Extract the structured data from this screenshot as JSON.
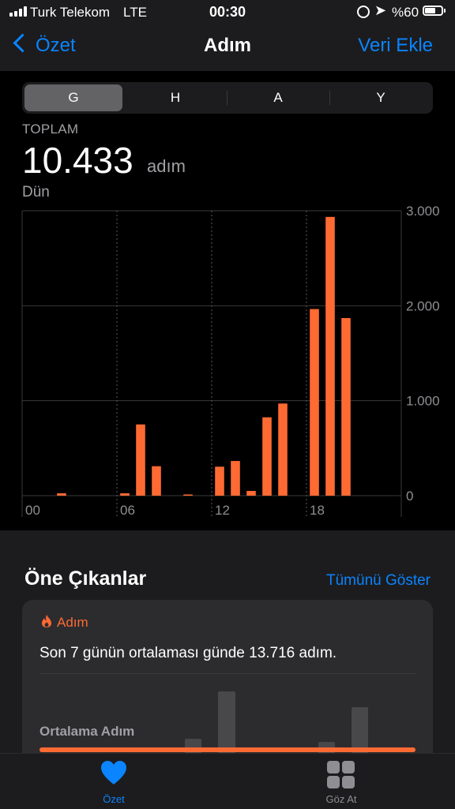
{
  "status_bar": {
    "carrier": "Turk Telekom",
    "network": "LTE",
    "time": "00:30",
    "battery": "%60",
    "icons": [
      "signal-icon",
      "rotation-lock-icon",
      "location-icon",
      "battery-icon"
    ]
  },
  "nav": {
    "back_label": "Özet",
    "title": "Adım",
    "add_label": "Veri Ekle"
  },
  "segments": [
    {
      "label": "G",
      "active": true
    },
    {
      "label": "H",
      "active": false
    },
    {
      "label": "A",
      "active": false
    },
    {
      "label": "Y",
      "active": false
    }
  ],
  "summary": {
    "total_label": "TOPLAM",
    "total_value": "10.433",
    "unit": "adım",
    "date": "Dün"
  },
  "chart_data": {
    "type": "bar",
    "x_ticks": [
      "00",
      "06",
      "12",
      "18"
    ],
    "y_ticks": [
      "3.000",
      "2.000",
      "1.000",
      "0"
    ],
    "ylim": [
      0,
      3000
    ],
    "bar_color": "#ff6a33",
    "hours": [
      0,
      1,
      2,
      3,
      4,
      5,
      6,
      7,
      8,
      9,
      10,
      11,
      12,
      13,
      14,
      15,
      16,
      17,
      18,
      19,
      20,
      21,
      22,
      23
    ],
    "values": [
      0,
      0,
      25,
      0,
      0,
      0,
      25,
      750,
      310,
      0,
      10,
      0,
      305,
      365,
      50,
      825,
      970,
      0,
      1965,
      2935,
      1870,
      0,
      0,
      0
    ]
  },
  "highlights": {
    "title": "Öne Çıkanlar",
    "show_all": "Tümünü Göster",
    "card": {
      "category": "Adım",
      "text": "Son 7 günün ortalaması günde 13.716 adım.",
      "avg_label": "Ortalama Adım"
    }
  },
  "tab_bar": {
    "items": [
      {
        "label": "Özet",
        "icon": "heart-icon",
        "active": true
      },
      {
        "label": "Göz At",
        "icon": "grid-icon",
        "active": false
      }
    ]
  },
  "colors": {
    "accent": "#0a84ff",
    "steps": "#ff6a33",
    "background": "#000000",
    "panel": "#1c1c1e"
  }
}
